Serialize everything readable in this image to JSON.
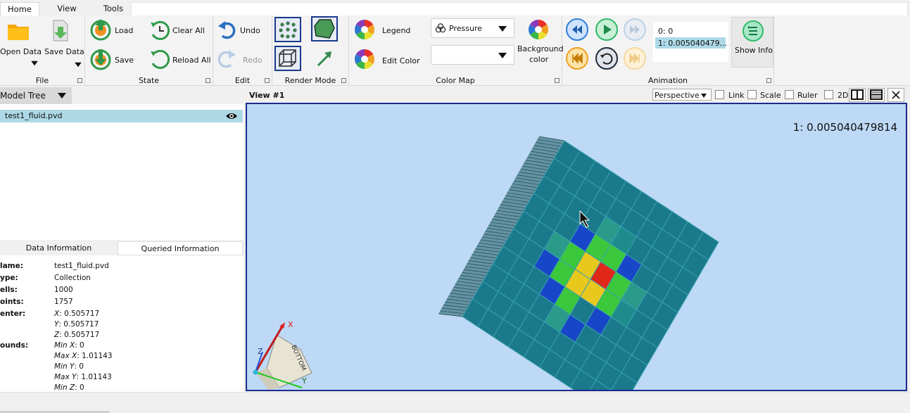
{
  "tabs": [
    "Home",
    "View",
    "Tools"
  ],
  "ribbon": {
    "file": {
      "label": "File",
      "open": "Open Data",
      "save": "Save Data"
    },
    "state": {
      "label": "State",
      "load": "Load",
      "save": "Save",
      "clear_all": "Clear All",
      "reload_all": "Reload All"
    },
    "edit": {
      "label": "Edit",
      "undo": "Undo",
      "redo": "Redo"
    },
    "render": {
      "label": "Render Mode"
    },
    "colormap": {
      "label": "Color Map",
      "legend": "Legend",
      "edit_color": "Edit Color",
      "array": "Pressure",
      "component": "",
      "background_1": "Background",
      "background_2": "color"
    },
    "animation": {
      "label": "Animation",
      "times": [
        "0: 0",
        "1: 0.005040479..."
      ],
      "show_info": "Show Info"
    }
  },
  "model_tree": {
    "title": "Model Tree",
    "items": [
      "test1_fluid.pvd"
    ]
  },
  "info": {
    "tabs": [
      "Data Information",
      "Queried Information"
    ],
    "rows": [
      {
        "key": "lame:",
        "val": "test1_fluid.pvd"
      },
      {
        "key": "ype:",
        "val": "Collection"
      },
      {
        "key": "ells:",
        "val": "1000"
      },
      {
        "key": "oints:",
        "val": "1757"
      },
      {
        "key": "enter:",
        "val": "",
        "sub": [
          {
            "k": "X",
            "v": ": 0.505717"
          },
          {
            "k": "Y",
            "v": ": 0.505717"
          },
          {
            "k": "Z",
            "v": ": 0.505717"
          }
        ]
      },
      {
        "key": "ounds:",
        "val": "",
        "sub": [
          {
            "k": "Min X",
            "v": ": 0"
          },
          {
            "k": "Max X",
            "v": ": 1.01143"
          },
          {
            "k": "Min Y",
            "v": ": 0"
          },
          {
            "k": "Max Y",
            "v": ": 1.01143"
          },
          {
            "k": "Min Z",
            "v": ": 0"
          }
        ]
      }
    ]
  },
  "view": {
    "title": "View #1",
    "projection": "Perspective",
    "options": [
      "Link",
      "Scale",
      "Ruler",
      "2D"
    ],
    "time_label": "1: 0.005040479814",
    "axes": {
      "x": "X",
      "y": "Y",
      "z": "Z",
      "face": "BOTTOM"
    }
  },
  "colors": {
    "accent": "#1c2c8c",
    "viewport_bg": "#bdd9f5",
    "cell_base": "#1a7a8c",
    "cell_blue": "#1846c8",
    "cell_green": "#3cc83c",
    "cell_yellow": "#e8c81c",
    "cell_red": "#e02818",
    "selection": "#add8e6"
  }
}
